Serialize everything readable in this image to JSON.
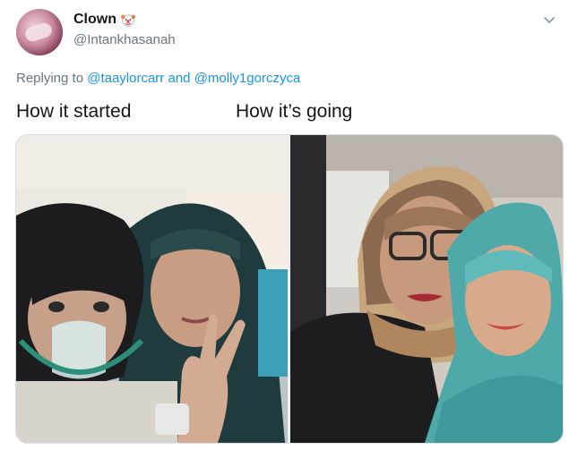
{
  "tweet": {
    "display_name": "Clown",
    "handle": "@Intankhasanah",
    "reply_prefix": "Replying to",
    "reply_mentions": [
      "@taaylorcarr",
      "@molly1gorczyca"
    ],
    "reply_joiner": "and",
    "caption_left": "How it started",
    "caption_right": "How it’s going"
  },
  "icons": {
    "name_emoji": "clown-face-icon",
    "menu": "chevron-down-icon"
  },
  "colors": {
    "link": "#1b95e0",
    "secondary_text": "#657786",
    "primary_text": "#14171a"
  }
}
